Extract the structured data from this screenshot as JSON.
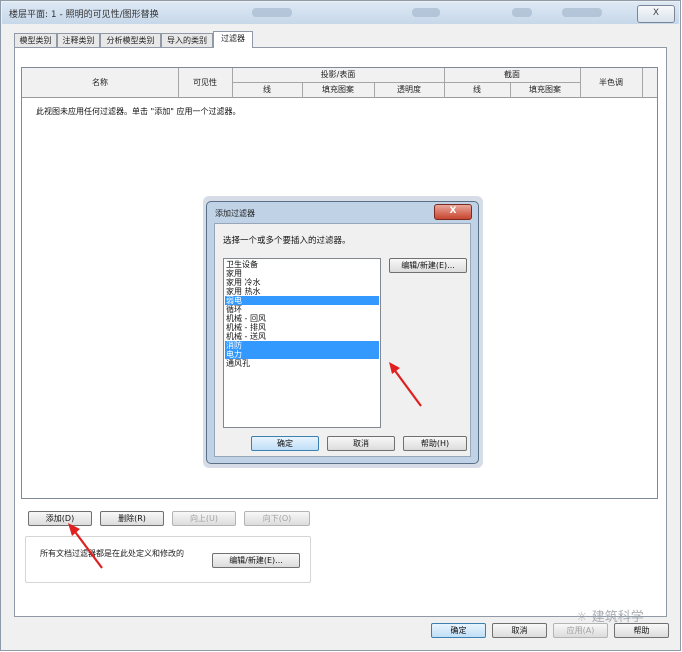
{
  "window": {
    "title": "楼层平面: 1 - 照明的可见性/图形替换",
    "close_glyph": "X"
  },
  "tabs": [
    {
      "label": "模型类别",
      "active": false
    },
    {
      "label": "注释类别",
      "active": false
    },
    {
      "label": "分析模型类别",
      "active": false
    },
    {
      "label": "导入的类别",
      "active": false
    },
    {
      "label": "过滤器",
      "active": true
    }
  ],
  "grid": {
    "headers": {
      "name": "名称",
      "visibility": "可见性",
      "projection_group": "投影/表面",
      "cut_group": "截面",
      "halftone": "半色调",
      "proj_line": "线",
      "proj_fill": "填充图案",
      "proj_transparency": "透明度",
      "cut_line": "线",
      "cut_fill": "填充图案"
    },
    "empty_message": "此视图未应用任何过滤器。单击 \"添加\" 应用一个过滤器。"
  },
  "actions": {
    "add": "添加(D)",
    "delete": "删除(R)",
    "up": "向上(U)",
    "down": "向下(O)"
  },
  "group_note": {
    "text": "所有文档过滤器都是在此处定义和修改的",
    "edit_button": "编辑/新建(E)..."
  },
  "footer": {
    "ok": "确定",
    "cancel": "取消",
    "apply": "应用(A)",
    "help": "帮助"
  },
  "dialog": {
    "title": "添加过滤器",
    "close_glyph": "X",
    "prompt": "选择一个或多个要插入的过滤器。",
    "edit_button": "编辑/新建(E)...",
    "items": [
      {
        "label": "卫生设备",
        "selected": false
      },
      {
        "label": "家用",
        "selected": false
      },
      {
        "label": "家用 冷水",
        "selected": false
      },
      {
        "label": "家用 热水",
        "selected": false
      },
      {
        "label": "弱电",
        "selected": true
      },
      {
        "label": "循环",
        "selected": false
      },
      {
        "label": "机械 - 回风",
        "selected": false
      },
      {
        "label": "机械 - 排风",
        "selected": false
      },
      {
        "label": "机械 - 送风",
        "selected": false
      },
      {
        "label": "消防",
        "selected": true
      },
      {
        "label": "电力",
        "selected": true
      },
      {
        "label": "通风孔",
        "selected": false
      }
    ],
    "ok": "确定",
    "cancel": "取消",
    "help": "帮助(H)"
  },
  "watermark": {
    "text": "建筑科学"
  },
  "colors": {
    "selection": "#3399ff",
    "annotation_arrow": "#e02020",
    "dialog_frame": "#bfd2e6"
  }
}
